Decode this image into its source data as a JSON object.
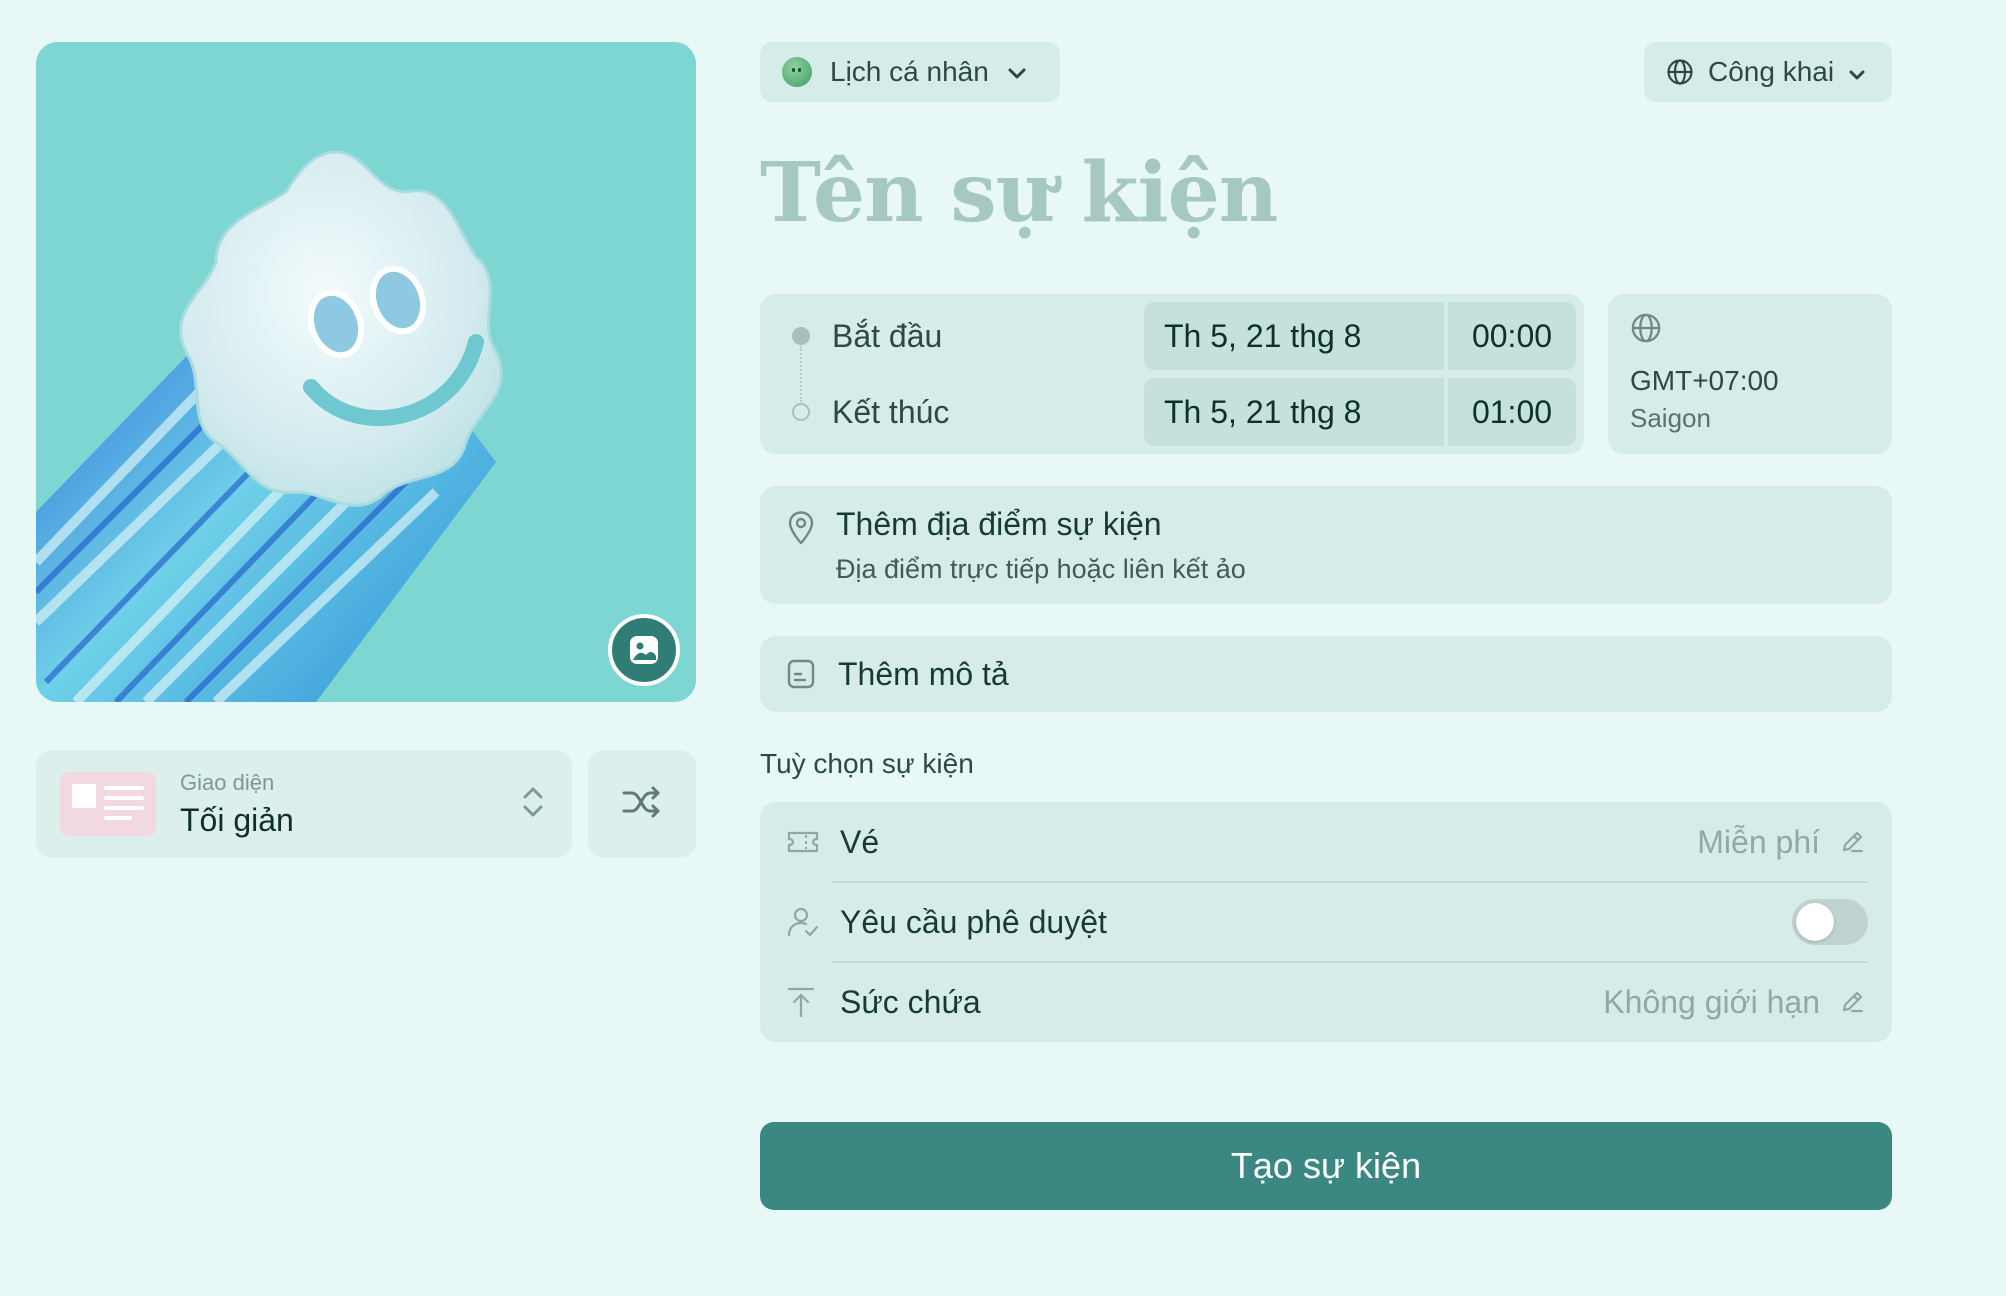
{
  "cover": {
    "change_image_icon": "image-icon"
  },
  "theme": {
    "label": "Giao diện",
    "value": "Tối giản",
    "shuffle_icon": "shuffle-icon"
  },
  "calendar_selector": {
    "label": "Lịch cá nhân"
  },
  "visibility_selector": {
    "label": "Công khai"
  },
  "event": {
    "title_placeholder": "Tên sự kiện"
  },
  "datetime": {
    "start": {
      "label": "Bắt đầu",
      "date": "Th 5, 21 thg 8",
      "time": "00:00"
    },
    "end": {
      "label": "Kết thúc",
      "date": "Th 5, 21 thg 8",
      "time": "01:00"
    }
  },
  "timezone": {
    "offset": "GMT+07:00",
    "city": "Saigon"
  },
  "location": {
    "title": "Thêm địa điểm sự kiện",
    "subtitle": "Địa điểm trực tiếp hoặc liên kết ảo"
  },
  "description": {
    "title": "Thêm mô tả"
  },
  "options": {
    "heading": "Tuỳ chọn sự kiện",
    "items": [
      {
        "label": "Vé",
        "value": "Miễn phí",
        "icon": "ticket-icon"
      },
      {
        "label": "Yêu cầu phê duyệt",
        "toggle": false,
        "icon": "user-check-icon"
      },
      {
        "label": "Sức chứa",
        "value": "Không giới hạn",
        "icon": "capacity-icon"
      }
    ]
  },
  "create_button": {
    "label": "Tạo sự kiện"
  },
  "colors": {
    "background": "#e8f8f6",
    "card": "#d6ece8",
    "primary": "#3b8882",
    "cover_bg": "#7dd6d2"
  }
}
